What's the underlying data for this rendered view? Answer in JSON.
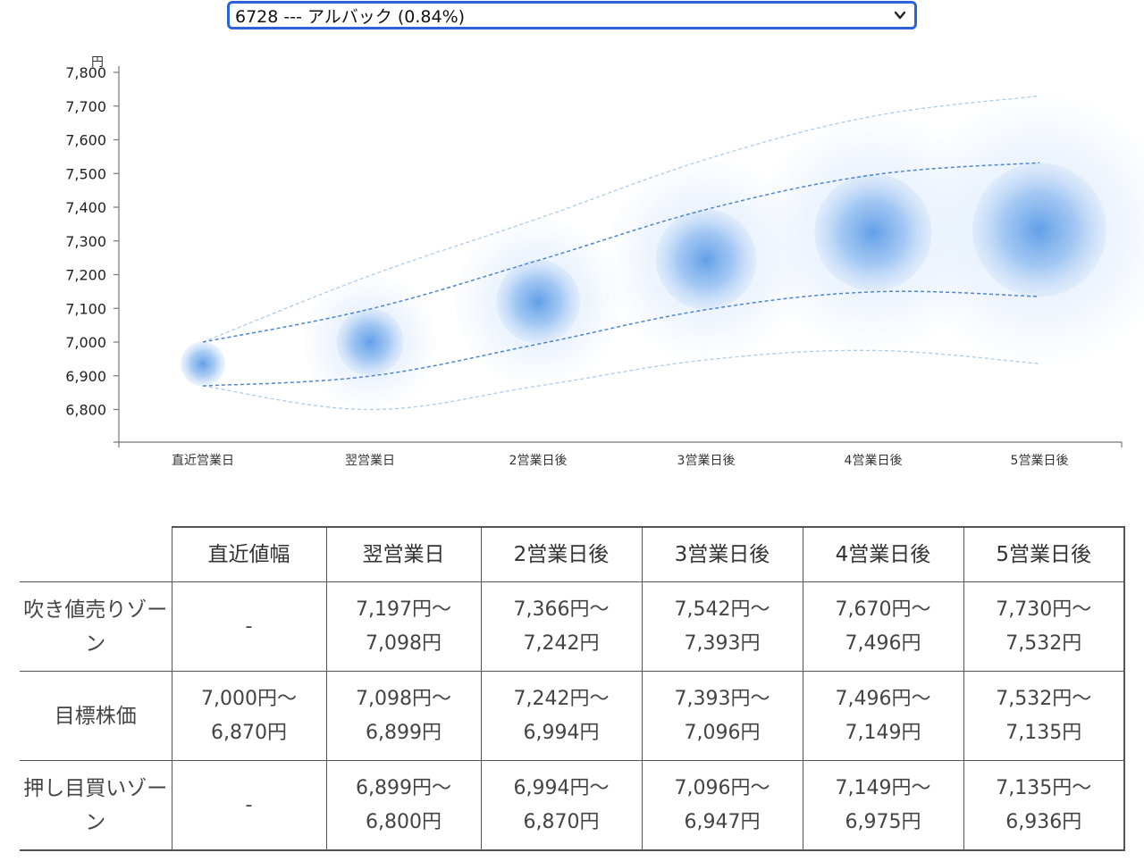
{
  "selector": {
    "selected_label": "6728 --- アルバック (0.84%)",
    "icon": "chevron-down-icon"
  },
  "chart_data": {
    "type": "bubble-forecast",
    "y_unit_label": "円",
    "ylim": [
      6750,
      7800
    ],
    "yticks": [
      6800,
      6900,
      7000,
      7100,
      7200,
      7300,
      7400,
      7500,
      7600,
      7700,
      7800
    ],
    "ytick_labels": [
      "6,800",
      "6,900",
      "7,000",
      "7,100",
      "7,200",
      "7,300",
      "7,400",
      "7,500",
      "7,600",
      "7,700",
      "7,800"
    ],
    "categories": [
      "直近営業日",
      "翌営業日",
      "2営業日後",
      "3営業日後",
      "4営業日後",
      "5営業日後"
    ],
    "center": [
      6935,
      7000,
      7120,
      7245,
      7325,
      7333
    ],
    "target_upper": [
      7000,
      7098,
      7242,
      7393,
      7496,
      7532
    ],
    "target_lower": [
      6870,
      6899,
      6994,
      7096,
      7149,
      7135
    ],
    "outer_upper": [
      7000,
      7197,
      7366,
      7542,
      7670,
      7730
    ],
    "outer_lower": [
      6870,
      6800,
      6870,
      6947,
      6975,
      6936
    ],
    "colors": {
      "core": "#5b9be6",
      "halo": "#d6e6fb",
      "inner_line": "#4d86cf",
      "outer_line": "#aecbec",
      "axis": "#777777"
    },
    "grid": false
  },
  "table": {
    "headers": [
      "",
      "直近値幅",
      "翌営業日",
      "2営業日後",
      "3営業日後",
      "4営業日後",
      "5営業日後"
    ],
    "rows": [
      {
        "label": "吹き値売りゾーン",
        "cells": [
          [
            "-"
          ],
          [
            "7,197円〜",
            "7,098円"
          ],
          [
            "7,366円〜",
            "7,242円"
          ],
          [
            "7,542円〜",
            "7,393円"
          ],
          [
            "7,670円〜",
            "7,496円"
          ],
          [
            "7,730円〜",
            "7,532円"
          ]
        ]
      },
      {
        "label": "目標株価",
        "cells": [
          [
            "7,000円〜",
            "6,870円"
          ],
          [
            "7,098円〜",
            "6,899円"
          ],
          [
            "7,242円〜",
            "6,994円"
          ],
          [
            "7,393円〜",
            "7,096円"
          ],
          [
            "7,496円〜",
            "7,149円"
          ],
          [
            "7,532円〜",
            "7,135円"
          ]
        ]
      },
      {
        "label": "押し目買いゾーン",
        "cells": [
          [
            "-"
          ],
          [
            "6,899円〜",
            "6,800円"
          ],
          [
            "6,994円〜",
            "6,870円"
          ],
          [
            "7,096円〜",
            "6,947円"
          ],
          [
            "7,149円〜",
            "6,975円"
          ],
          [
            "7,135円〜",
            "6,936円"
          ]
        ]
      }
    ]
  }
}
